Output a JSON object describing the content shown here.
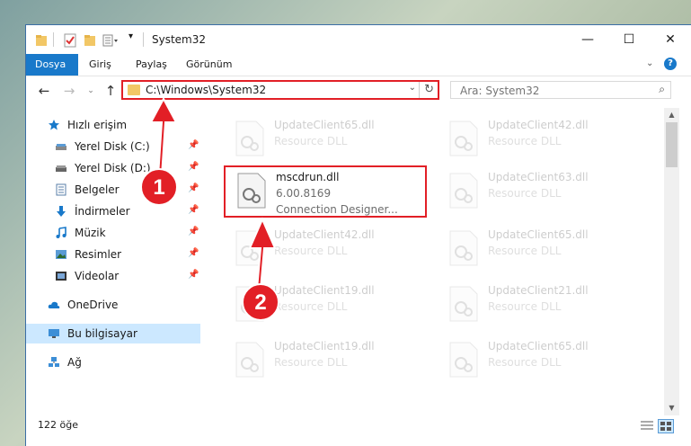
{
  "window": {
    "title": "System32",
    "controls": {
      "minimize": "—",
      "maximize": "☐",
      "close": "✕"
    }
  },
  "ribbon": {
    "tabs": [
      {
        "label": "Dosya",
        "active": true
      },
      {
        "label": "Giriş"
      },
      {
        "label": "Paylaş"
      },
      {
        "label": "Görünüm"
      }
    ],
    "help": "?"
  },
  "address": {
    "path": "C:\\Windows\\System32",
    "search_placeholder": "Ara: System32"
  },
  "sidebar": {
    "items": [
      {
        "label": "Hızlı erişim",
        "icon": "star-icon"
      },
      {
        "label": "Yerel Disk (C:)",
        "icon": "drive-icon",
        "pinned": true
      },
      {
        "label": "Yerel Disk (D:)",
        "icon": "drive-icon",
        "pinned": true
      },
      {
        "label": "Belgeler",
        "icon": "documents-icon",
        "pinned": true
      },
      {
        "label": "İndirmeler",
        "icon": "download-icon",
        "pinned": true
      },
      {
        "label": "Müzik",
        "icon": "music-icon",
        "pinned": true
      },
      {
        "label": "Resimler",
        "icon": "pictures-icon",
        "pinned": true
      },
      {
        "label": "Videolar",
        "icon": "videos-icon",
        "pinned": true
      },
      {
        "label": "OneDrive",
        "icon": "cloud-icon"
      },
      {
        "label": "Bu bilgisayar",
        "icon": "computer-icon",
        "selected": true
      },
      {
        "label": "Ağ",
        "icon": "network-icon"
      }
    ]
  },
  "files": [
    {
      "name": "UpdateClient65.dll",
      "type": "Resource DLL",
      "faded": true
    },
    {
      "name": "UpdateClient42.dll",
      "type": "Resource DLL",
      "faded": true
    },
    {
      "name": "mscdrun.dll",
      "version": "6.00.8169",
      "desc": "Connection Designer...",
      "highlight": true
    },
    {
      "name": "UpdateClient63.dll",
      "type": "Resource DLL",
      "faded": true
    },
    {
      "name": "UpdateClient42.dll",
      "type": "Resource DLL",
      "faded": true
    },
    {
      "name": "UpdateClient65.dll",
      "type": "Resource DLL",
      "faded": true
    },
    {
      "name": "UpdateClient19.dll",
      "type": "Resource DLL",
      "faded": true
    },
    {
      "name": "UpdateClient21.dll",
      "type": "Resource DLL",
      "faded": true
    },
    {
      "name": "UpdateClient19.dll",
      "type": "Resource DLL",
      "faded": true
    },
    {
      "name": "UpdateClient65.dll",
      "type": "Resource DLL",
      "faded": true
    }
  ],
  "status": {
    "count": "122 öğe"
  },
  "annotations": {
    "step1": "1",
    "step2": "2",
    "color": "#e21f26"
  }
}
